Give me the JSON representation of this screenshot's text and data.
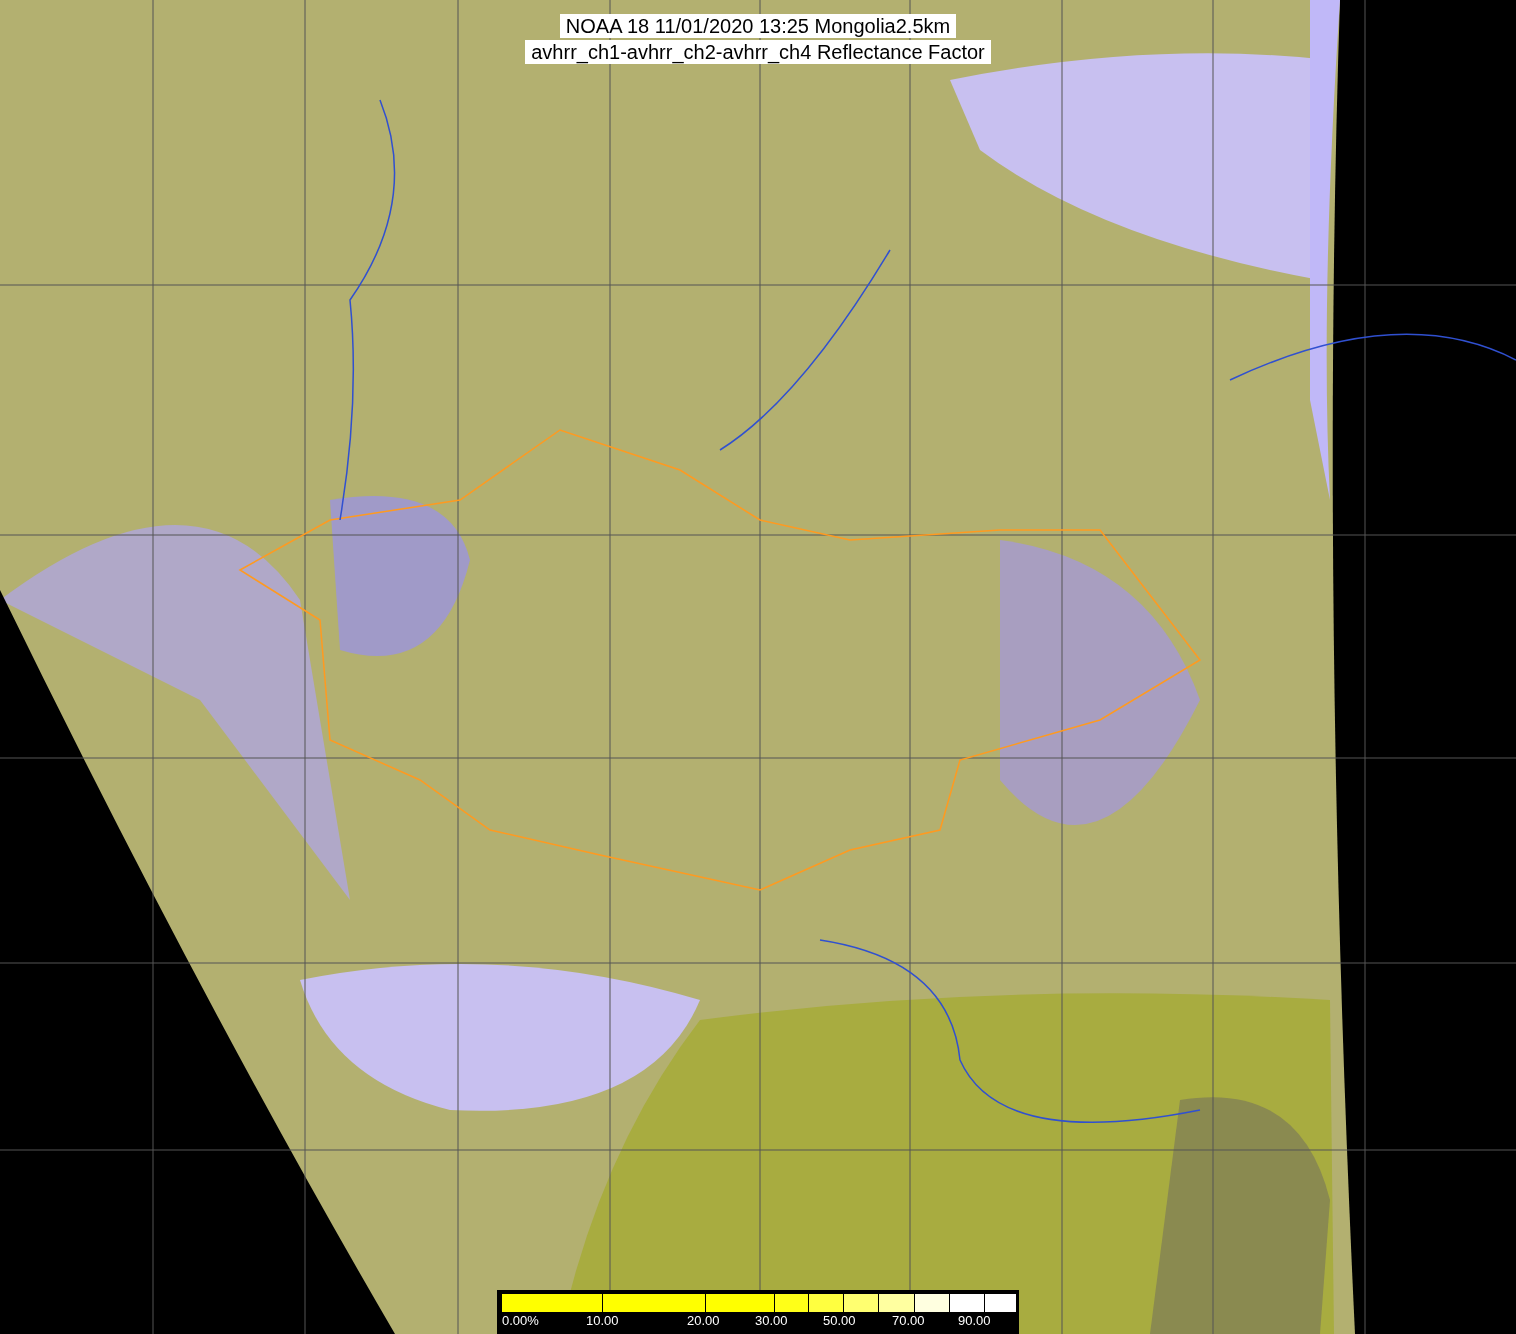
{
  "title_lines": [
    "NOAA 18 11/01/2020 13:25 Mongolia2.5km",
    "avhrr_ch1-avhrr_ch2-avhrr_ch4 Reflectance Factor"
  ],
  "legend": {
    "swatches": [
      {
        "color": "#ffff00"
      },
      {
        "color": "#ffff00"
      },
      {
        "color": "#ffff00"
      },
      {
        "color": "#ffff18"
      },
      {
        "color": "#ffff40"
      },
      {
        "color": "#ffff70"
      },
      {
        "color": "#ffffa0"
      },
      {
        "color": "#ffffe0"
      },
      {
        "color": "#ffffff"
      },
      {
        "color": "#ffffff"
      }
    ],
    "labels": [
      "0.00%",
      "10.00",
      "20.00",
      "30.00",
      "50.00",
      "70.00",
      "90.00"
    ]
  }
}
